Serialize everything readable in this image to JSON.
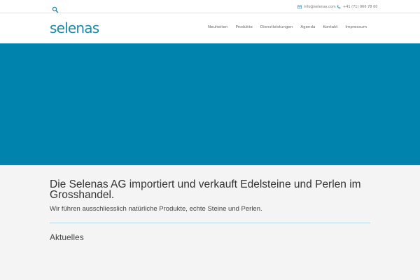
{
  "topbar": {
    "email": "info@selenas.com",
    "phone": "+41 (71) 966 78 60"
  },
  "header": {
    "logo": "selenas",
    "nav": [
      "Neuheiten",
      "Produkte",
      "Dienstleistungen",
      "Agenda",
      "Kontakt",
      "Impressum"
    ]
  },
  "colors": {
    "accent": "#0083ad",
    "logo": "#1d8aaa"
  },
  "icons": {
    "search": "search-icon",
    "email": "envelope-icon",
    "phone": "phone-icon"
  },
  "main": {
    "headline": "Die Selenas AG importiert und verkauft Edelsteine und Perlen im Grosshandel.",
    "subline": "Wir führen ausschliesslich natürliche Produkte, echte Steine und Perlen.",
    "section_title": "Aktuelles"
  }
}
